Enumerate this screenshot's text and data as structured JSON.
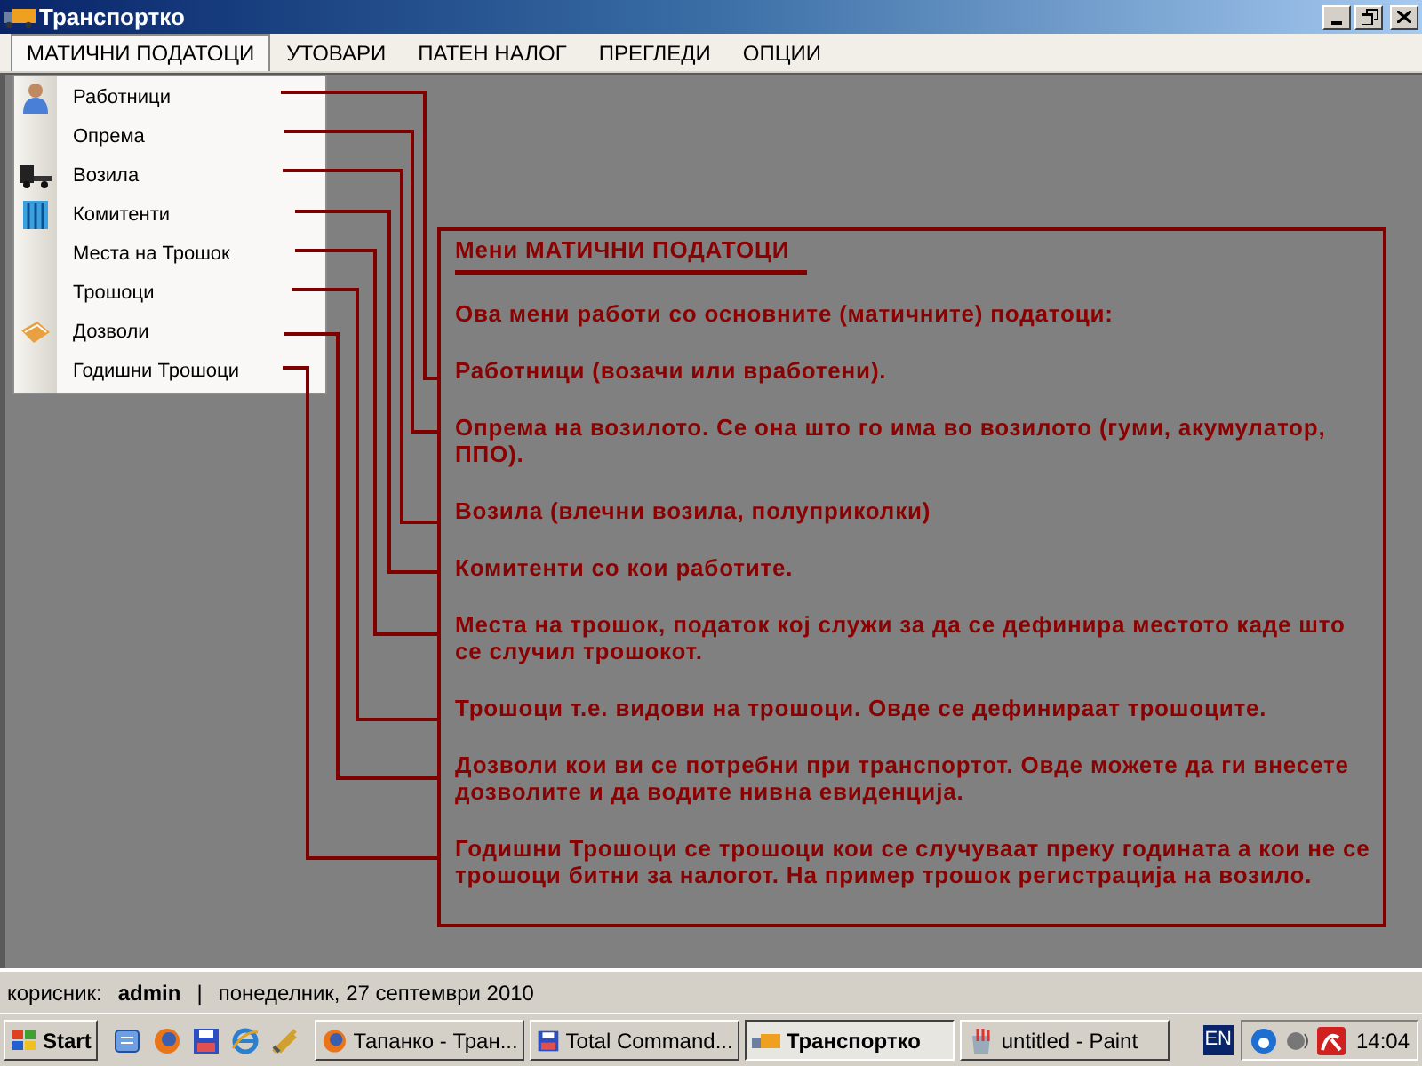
{
  "window": {
    "title": "Транспортко"
  },
  "menu_bar": [
    {
      "label": "МАТИЧНИ ПОДАТОЦИ",
      "selected": true
    },
    {
      "label": "УТОВАРИ",
      "selected": false
    },
    {
      "label": "ПАТЕН НАЛОГ",
      "selected": false
    },
    {
      "label": "ПРЕГЛЕДИ",
      "selected": false
    },
    {
      "label": "ОПЦИИ",
      "selected": false
    }
  ],
  "dropdown": {
    "items": [
      {
        "label": "Работници",
        "kind": "worker"
      },
      {
        "label": "Опрема",
        "kind": "text"
      },
      {
        "label": "Возила",
        "kind": "vehicle"
      },
      {
        "label": "Комитенти",
        "kind": "client"
      },
      {
        "label": "Места на Трошок",
        "kind": "text"
      },
      {
        "label": "Трошоци",
        "kind": "text"
      },
      {
        "label": "Дозволи",
        "kind": "permit"
      },
      {
        "label": "Годишни Трошоци",
        "kind": "text"
      }
    ]
  },
  "help_box": {
    "title": "Мени МАТИЧНИ ПОДАТОЦИ",
    "paragraphs": [
      "Ова мени работи со основните (матичните) податоци:",
      "Работници (возачи или вработени).",
      "Опрема на возилото. Се она што го има во возилото (гуми, акумулатор, ППО).",
      "Возила (влечни возила, полуприколки)",
      "Комитенти со кои работите.",
      "Места на трошок, податок кој служи за да се дефинира местото каде што се случил трошокот.",
      "Трошоци т.е. видови на трошоци. Овде се дефинираат трошоците.",
      "Дозволи кои ви се потребни при транспортот. Овде можете да ги внесете дозволите и да водите нивна евиденција.",
      "Годишни Трошоци се трошоци кои се случуваат преку годината а кои не се трошоци битни за налогот. На пример трошок регистрација на возило."
    ]
  },
  "status_bar": {
    "user_label": "корисник:",
    "user": "admin",
    "separator": "|",
    "date": "понеделник, 27 септември 2010"
  },
  "taskbar": {
    "start": "Start",
    "tasks": [
      {
        "label": "Тапанко - Тран...",
        "kind": "browser",
        "selected": false
      },
      {
        "label": "Total Command...",
        "kind": "disk",
        "selected": false
      },
      {
        "label": "Транспортко",
        "kind": "truck",
        "selected": true
      },
      {
        "label": "untitled - Paint",
        "kind": "paint",
        "selected": false
      }
    ],
    "language": "EN",
    "clock": "14:04"
  }
}
